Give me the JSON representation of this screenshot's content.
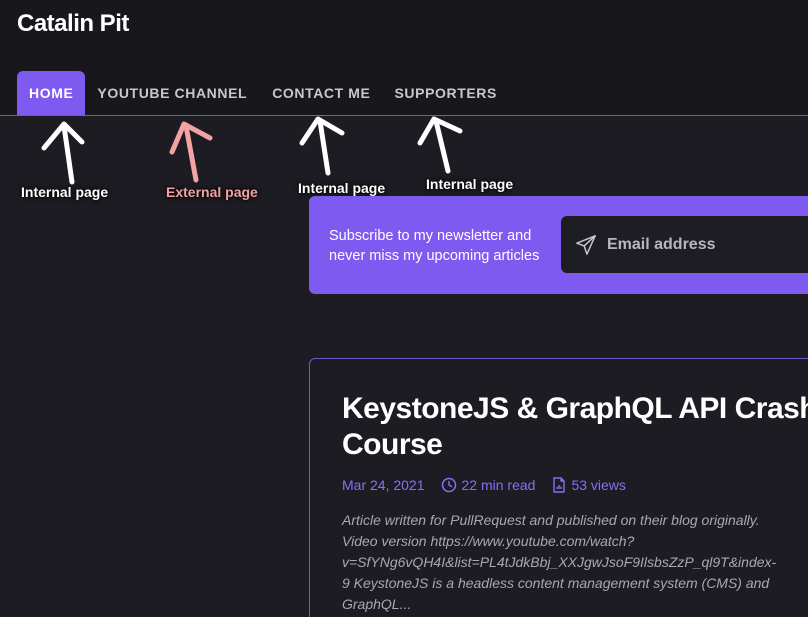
{
  "site": {
    "title": "Catalin Pit"
  },
  "nav": {
    "items": [
      {
        "label": "HOME",
        "active": true
      },
      {
        "label": "YOUTUBE CHANNEL"
      },
      {
        "label": "CONTACT ME"
      },
      {
        "label": "SUPPORTERS"
      }
    ]
  },
  "annotations": {
    "home": "Internal page",
    "youtube": "External page",
    "contact": "Internal page",
    "supporters": "Internal page",
    "colors": {
      "internal": "#ffffff",
      "external": "#f2a3a3"
    }
  },
  "newsletter": {
    "text": "Subscribe to my newsletter and never miss my upcoming articles",
    "placeholder": "Email address",
    "icon": "send-icon"
  },
  "article": {
    "title_line1": "KeystoneJS & GraphQL API Crash",
    "title_line2": "Course",
    "date": "Mar 24, 2021",
    "read_time": "22 min read",
    "views": "53 views",
    "excerpt_lines": [
      "Article written for PullRequest and published on their blog originally.",
      "Video version https://www.youtube.com/watch?",
      "v=SfYNg6vQH4I&list=PL4tJdkBbj_XXJgwJsoF9IlsbsZzP_ql9T&index-",
      "9 KeystoneJS is a headless content management system (CMS) and",
      "GraphQL..."
    ]
  },
  "colors": {
    "accent": "#7f5af0",
    "background": "#1d1c22",
    "header": "#18171c"
  }
}
